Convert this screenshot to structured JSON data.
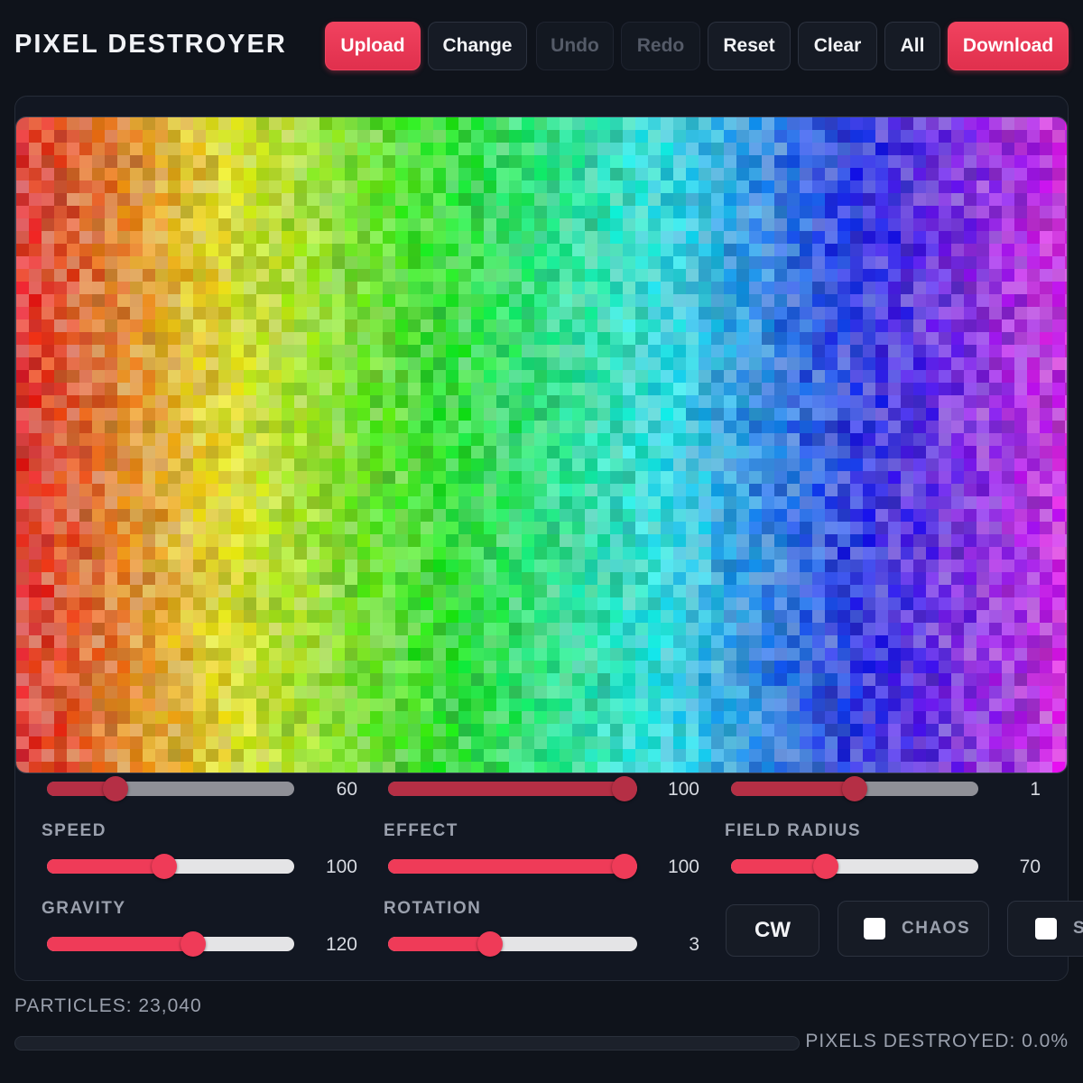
{
  "app": {
    "title": "PIXEL DESTROYER"
  },
  "toolbar": {
    "upload": "Upload",
    "change": "Change",
    "undo": "Undo",
    "redo": "Redo",
    "reset": "Reset",
    "clear": "Clear",
    "all": "All",
    "download": "Download"
  },
  "colors": {
    "accent": "#ef3b58",
    "background": "#0f131b",
    "panel": "#121722"
  },
  "controls": {
    "top_row": [
      {
        "value": "60",
        "fraction": 0.25
      },
      {
        "value": "100",
        "fraction": 1.0
      },
      {
        "value": "1",
        "fraction": 0.5
      }
    ],
    "speed": {
      "label": "SPEED",
      "value": "100",
      "fraction": 0.47
    },
    "effect": {
      "label": "EFFECT",
      "value": "100",
      "fraction": 1.0
    },
    "field_radius": {
      "label": "FIELD RADIUS",
      "value": "70",
      "fraction": 0.37
    },
    "gravity": {
      "label": "GRAVITY",
      "value": "120",
      "fraction": 0.6
    },
    "rotation": {
      "label": "ROTATION",
      "value": "3",
      "fraction": 0.4
    },
    "direction_button": "CW",
    "chaos_toggle": {
      "label": "CHAOS",
      "checked": false
    },
    "cut_toggle": {
      "label": "S",
      "checked": false
    }
  },
  "status": {
    "particles": "PARTICLES: 23,040",
    "pixels_destroyed": "PIXELS DESTROYED: 0.0%",
    "progress_fraction": 0.0
  }
}
